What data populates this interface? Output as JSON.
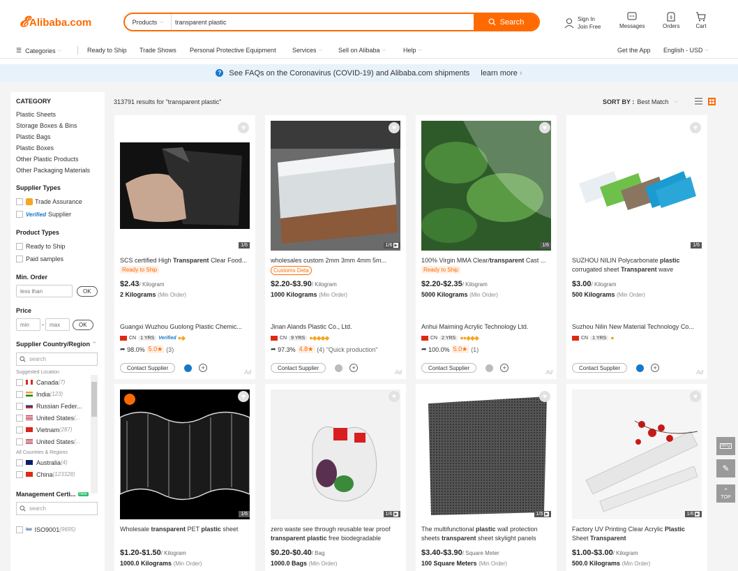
{
  "header": {
    "logo_text": "Alibaba.com",
    "search": {
      "category": "Products",
      "query": "transparent plastic",
      "button": "Search"
    },
    "sign_in": "Sign In",
    "join_free": "Join Free",
    "messages": "Messages",
    "orders": "Orders",
    "cart": "Cart"
  },
  "nav": {
    "categories": "Categories",
    "ready_to_ship": "Ready to Ship",
    "trade_shows": "Trade Shows",
    "ppe": "Personal Protective Equipment",
    "services": "Services",
    "sell": "Sell on Alibaba",
    "help": "Help",
    "get_app": "Get the App",
    "lang": "English - USD"
  },
  "banner": {
    "text": "See FAQs on the Coronavirus (COVID-19) and Alibaba.com shipments",
    "link": "learn more"
  },
  "sidebar": {
    "category_title": "CATEGORY",
    "categories": [
      "Plastic Sheets",
      "Storage Boxes & Bins",
      "Plastic Bags",
      "Plastic Boxes",
      "Other Plastic Products",
      "Other Packaging Materials"
    ],
    "supplier_types_title": "Supplier Types",
    "trade_assurance": "Trade Assurance",
    "verified": "Verified",
    "supplier": "Supplier",
    "product_types_title": "Product Types",
    "ready_to_ship": "Ready to Ship",
    "paid_samples": "Paid samples",
    "min_order_title": "Min. Order",
    "less_than": "less than",
    "ok": "OK",
    "price_title": "Price",
    "min": "min",
    "dash": "-",
    "max": "max",
    "country_title": "Supplier Country/Region",
    "search_placeholder": "search",
    "suggested": "Suggested Location",
    "all_countries": "All Countries & Regions",
    "countries_suggested": [
      {
        "name": "Canada",
        "count": "(7)",
        "flag": "ca"
      },
      {
        "name": "India",
        "count": "(123)",
        "flag": "in"
      },
      {
        "name": "Russian Feder...",
        "count": "",
        "flag": "ru"
      },
      {
        "name": "United States",
        "count": "(...",
        "flag": "us"
      },
      {
        "name": "Vietnam",
        "count": "(287)",
        "flag": "vn"
      },
      {
        "name": "United States",
        "count": "(...",
        "flag": "us"
      }
    ],
    "countries_all": [
      {
        "name": "Australia",
        "count": "(4)",
        "flag": "au"
      },
      {
        "name": "China",
        "count": "(123328)",
        "flag": "cn"
      }
    ],
    "management_title": "Management Certi...",
    "new_badge": "new",
    "iso": "ISO9001",
    "iso_count": "(9695)"
  },
  "results": {
    "count": "313791",
    "suffix": "results for \"transparent plastic\""
  },
  "sort": {
    "label": "SORT BY :",
    "value": "Best Match"
  },
  "colors": {
    "accent": "#ff6a00",
    "link": "#1777c9"
  },
  "products": [
    {
      "title_pre": "SCS certified High ",
      "title_bold": "Transparent",
      "title_post": " Clear Food...",
      "tag": "Ready to Ship",
      "price": "$2.43",
      "unit": "/ Kilogram",
      "moq": "2 Kilograms",
      "moq_note": "(Min Order)",
      "supplier": "Guangxi Wuzhou Guolong Plastic Chemic...",
      "country": "CN",
      "years": "1 YRS",
      "response": "98.0%",
      "score": "5.0",
      "reviews": "(3)",
      "count": "1/6",
      "contact": "Contact Supplier",
      "ad": "Ad"
    },
    {
      "title": "wholesales custom 2mm 3mm 4mm 5m...",
      "tag": "Customs Deta",
      "price": "$2.20-$3.90",
      "unit": "/ Kilogram",
      "moq": "1000 Kilograms",
      "moq_note": "(Min Order)",
      "supplier": "Jinan Alands Plastic Co., Ltd.",
      "country": "CN",
      "years": "9 YRS",
      "response": "97.3%",
      "score": "4.8",
      "reviews": "(4) \"Quick production\"",
      "count": "1/6",
      "contact": "Contact Supplier",
      "ad": "Ad"
    },
    {
      "title_pre": "100% Virgin MMA Clear/",
      "title_bold": "transparent",
      "title_post": " Cast ...",
      "tag": "Ready to Ship",
      "price": "$2.20-$2.35",
      "unit": "/ Kilogram",
      "moq": "5000 Kilograms",
      "moq_note": "(Min Order)",
      "supplier": "Anhui Maiming Acrylic Technology Ltd.",
      "country": "CN",
      "years": "2 YRS",
      "response": "100.0%",
      "score": "5.0",
      "reviews": "(1)",
      "count": "1/6",
      "contact": "Contact Supplier",
      "ad": "Ad"
    },
    {
      "title_l1_pre": "SUZHOU NILIN Polycarbonate ",
      "title_l1_bold": "plastic",
      "title_l2_pre": "corrugated sheet ",
      "title_l2_bold": "Transparent",
      "title_l2_post": " wave",
      "price": "$3.00",
      "unit": "/ Kilogram",
      "moq": "500 Kilograms",
      "moq_note": "(Min Order)",
      "supplier": "Suzhou Nilin New Material Technology Co...",
      "country": "CN",
      "years": "1 YRS",
      "count": "1/6",
      "contact": "Contact Supplier",
      "ad": "Ad"
    },
    {
      "title_pre": "Wholesale ",
      "title_bold": "transparent",
      "title_mid": " PET ",
      "title_bold2": "plastic",
      "title_post": " sheet",
      "price": "$1.20-$1.50",
      "unit": "/ Kilogram",
      "moq": "1000.0 Kilograms",
      "moq_note": "(Min Order)",
      "count": "1/6"
    },
    {
      "title_l1": "zero waste see through reusable tear proof",
      "title_l2_bold": "transparent plastic",
      "title_l2_post": " free biodegradable",
      "price": "$0.20-$0.40",
      "unit": "/ Bag",
      "moq": "1000.0 Bags",
      "moq_note": "(Min Order)",
      "count": "1/6"
    },
    {
      "title_l1_pre": "The multifunctional ",
      "title_l1_bold": "plastic",
      "title_l1_post": " wall protection",
      "title_l2_pre": "sheets ",
      "title_l2_bold": "transparent",
      "title_l2_post": " sheet skylight panels",
      "price": "$3.40-$3.90",
      "unit": "/ Square Meter",
      "moq": "100 Square Meters",
      "moq_note": "(Min Order)",
      "count": "1/5"
    },
    {
      "title_l1_pre": "Factory UV Printing Clear Acrylic ",
      "title_l1_bold": "Plastic",
      "title_l2_pre": "Sheet ",
      "title_l2_bold": "Transparent",
      "price": "$1.00-$3.00",
      "unit": "/ Kilogram",
      "moq": "500.0 Kilograms",
      "moq_note": "(Min Order)",
      "count": "1/6"
    }
  ],
  "float": {
    "rfq": "RFQ",
    "top": "TOP"
  }
}
